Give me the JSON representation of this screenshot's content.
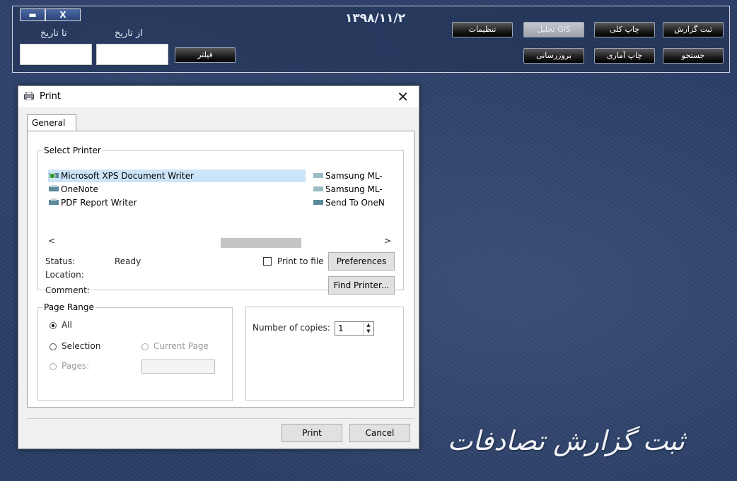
{
  "app": {
    "date": "۱۳۹۸/۱۱/۲",
    "from_date_label": "از تاریخ",
    "to_date_label": "تا تاریخ",
    "filter_button": "فیلتر",
    "buttons": {
      "settings": "تنظیمات",
      "gis": "تحلیل GIS",
      "print_all": "چاپ کلی",
      "register": "ثبت گزارش",
      "update": "بروزرسانی",
      "print_stats": "چاپ آماری",
      "search": "جستجو"
    },
    "brand": "ثبت گزارش تصادفات",
    "window_controls": {
      "minimize": "▬",
      "close": "X"
    }
  },
  "dialog": {
    "title": "Print",
    "close": "✕",
    "tab_general": "General",
    "select_printer_legend": "Select Printer",
    "printers": [
      "Microsoft XPS Document Writer",
      "OneNote",
      "PDF Report Writer",
      "Samsung ML-",
      "Samsung ML-",
      "Send To OneN"
    ],
    "scroll_left": "<",
    "scroll_right": ">",
    "status_label": "Status:",
    "status_value": "Ready",
    "location_label": "Location:",
    "comment_label": "Comment:",
    "print_to_file": "Print to file",
    "preferences": "Preferences",
    "find_printer": "Find Printer...",
    "page_range_legend": "Page Range",
    "range_all": "All",
    "range_selection": "Selection",
    "range_current_page": "Current Page",
    "range_pages": "Pages:",
    "copies_label": "Number of copies:",
    "copies_value": "1",
    "print_button": "Print",
    "cancel_button": "Cancel"
  },
  "colors": {
    "background": "#2a3e66",
    "selection": "#cce4f7",
    "dialog_bg": "#f0f0f0"
  }
}
